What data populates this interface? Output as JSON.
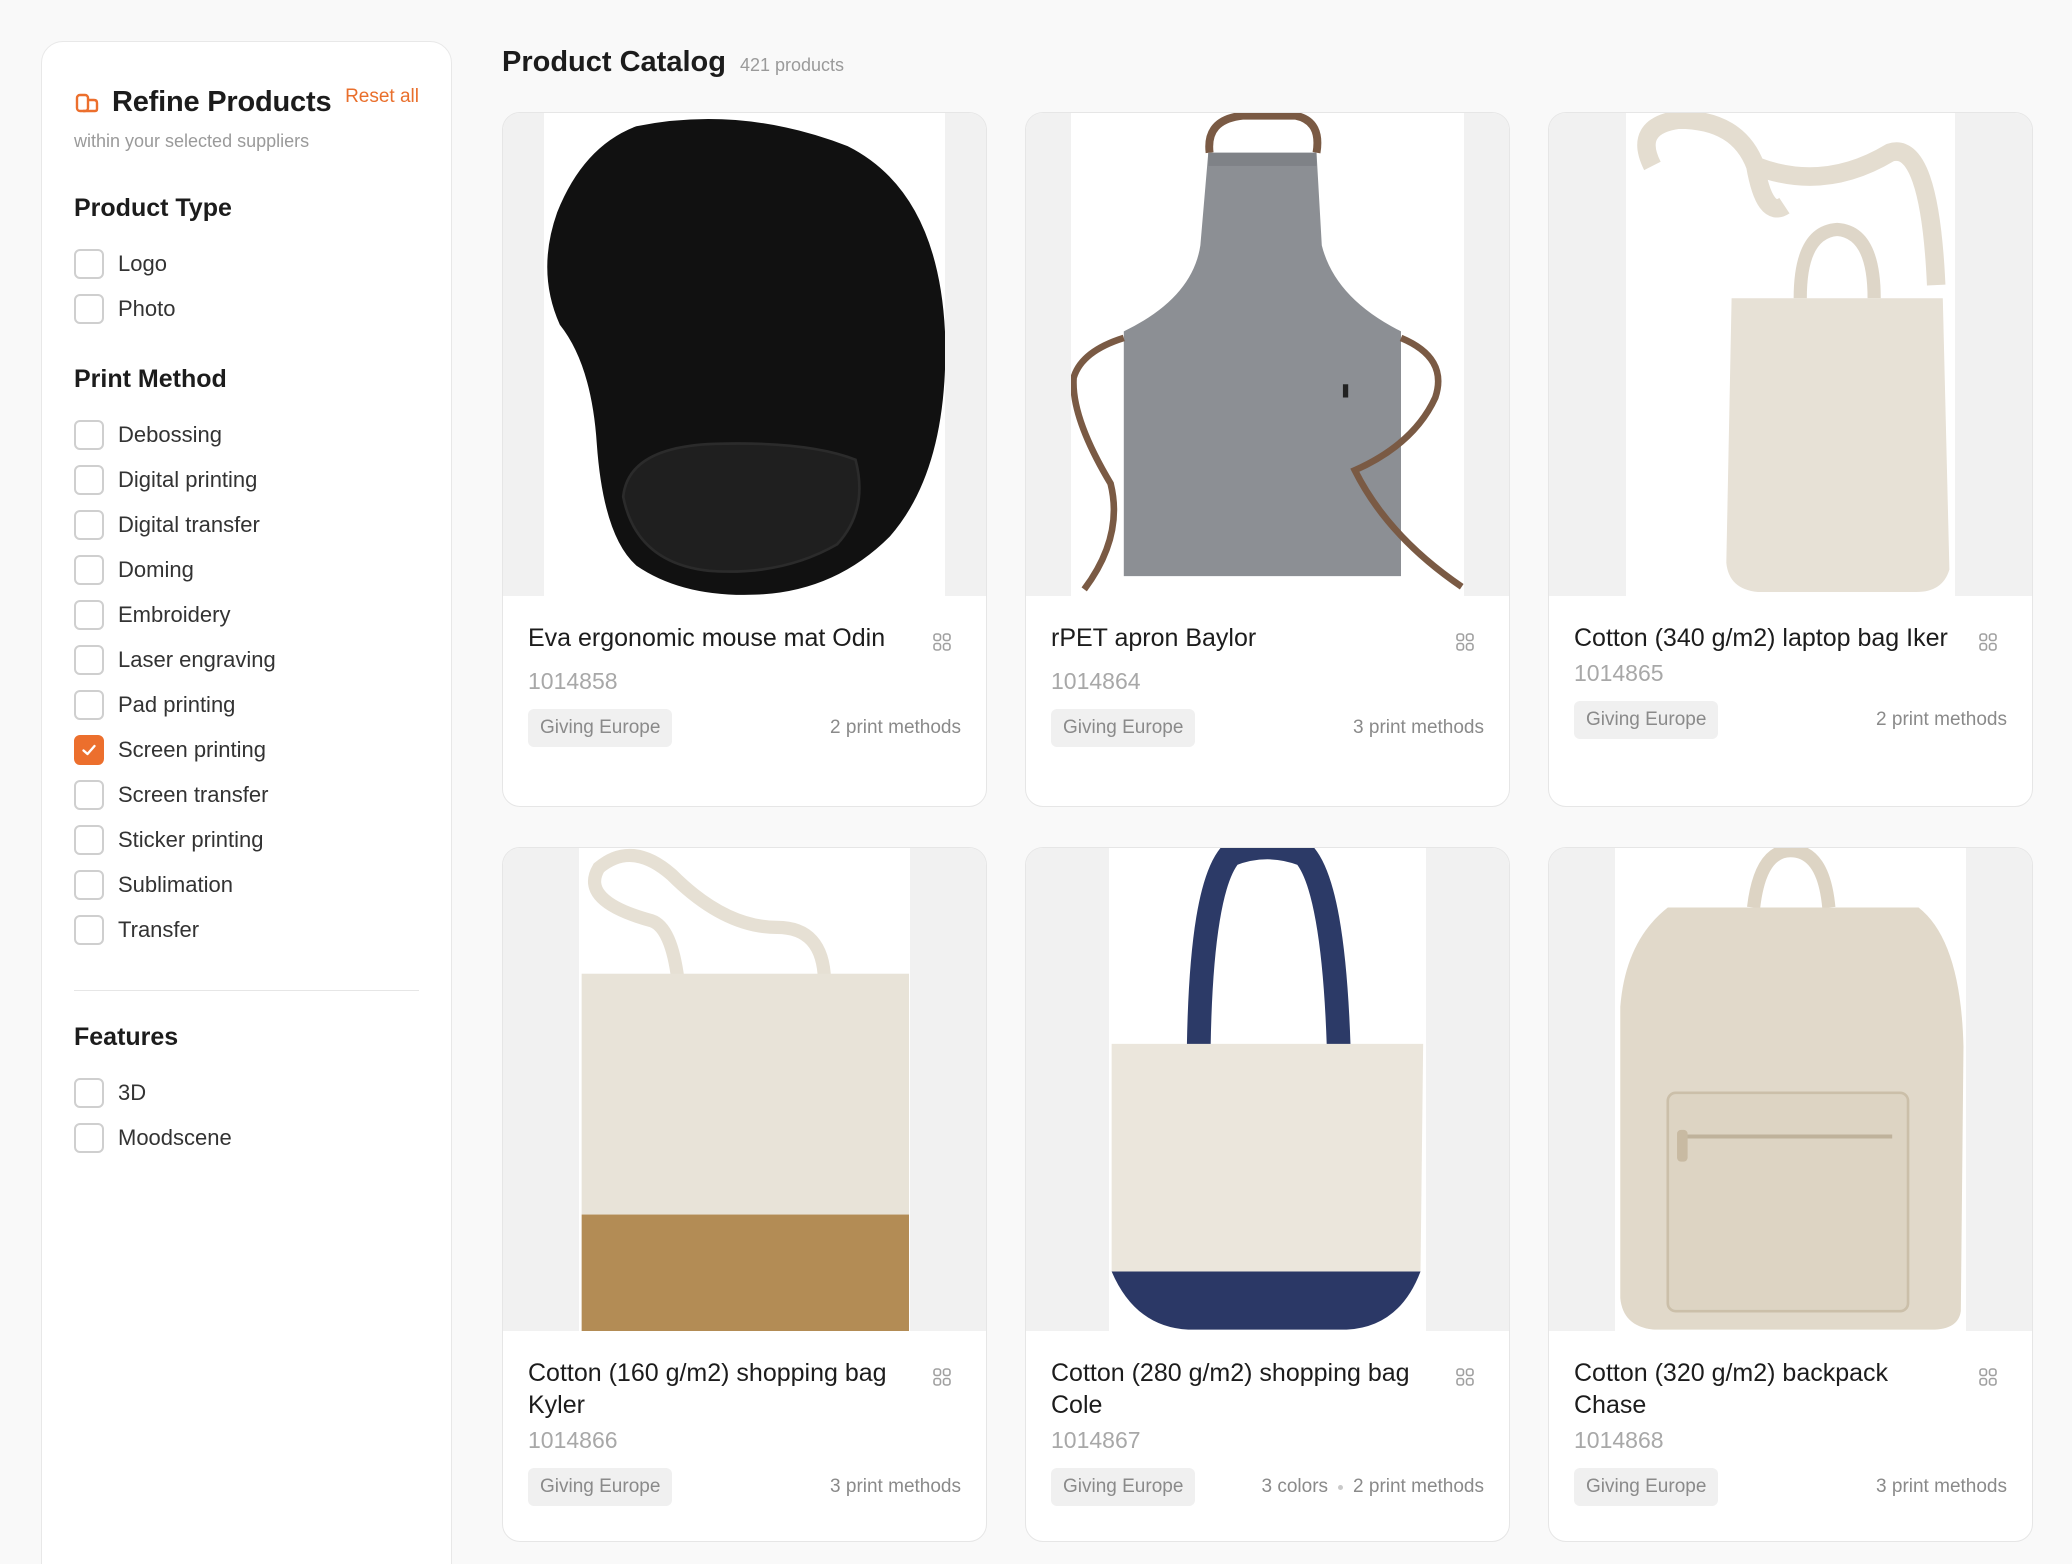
{
  "sidebar": {
    "title": "Refine Products",
    "reset_label": "Reset all",
    "subtitle": "within your selected suppliers",
    "groups": [
      {
        "title": "Product Type",
        "options": [
          {
            "label": "Logo",
            "checked": false
          },
          {
            "label": "Photo",
            "checked": false
          }
        ]
      },
      {
        "title": "Print Method",
        "options": [
          {
            "label": "Debossing",
            "checked": false
          },
          {
            "label": "Digital printing",
            "checked": false
          },
          {
            "label": "Digital transfer",
            "checked": false
          },
          {
            "label": "Doming",
            "checked": false
          },
          {
            "label": "Embroidery",
            "checked": false
          },
          {
            "label": "Laser engraving",
            "checked": false
          },
          {
            "label": "Pad printing",
            "checked": false
          },
          {
            "label": "Screen printing",
            "checked": true
          },
          {
            "label": "Screen transfer",
            "checked": false
          },
          {
            "label": "Sticker printing",
            "checked": false
          },
          {
            "label": "Sublimation",
            "checked": false
          },
          {
            "label": "Transfer",
            "checked": false
          }
        ]
      },
      {
        "title": "Features",
        "options": [
          {
            "label": "3D",
            "checked": false
          },
          {
            "label": "Moodscene",
            "checked": false
          }
        ]
      }
    ]
  },
  "catalog": {
    "title": "Product Catalog",
    "count_label": "421 products",
    "products": [
      {
        "name": "Eva ergonomic mouse mat Odin",
        "sku": "1014858",
        "supplier": "Giving Europe",
        "colors": "",
        "methods": "2 print methods",
        "image": "mouse-mat"
      },
      {
        "name": "rPET apron Baylor",
        "sku": "1014864",
        "supplier": "Giving Europe",
        "colors": "",
        "methods": "3 print methods",
        "image": "apron"
      },
      {
        "name": "Cotton (340 g/m2) laptop bag Iker",
        "sku": "1014865",
        "supplier": "Giving Europe",
        "colors": "",
        "methods": "2 print methods",
        "image": "laptop-bag"
      },
      {
        "name": "Cotton (160 g/m2) shopping bag Kyler",
        "sku": "1014866",
        "supplier": "Giving Europe",
        "colors": "",
        "methods": "3 print methods",
        "image": "shopping-bag-kyler"
      },
      {
        "name": "Cotton (280 g/m2) shopping bag Cole",
        "sku": "1014867",
        "supplier": "Giving Europe",
        "colors": "3 colors",
        "methods": "2 print methods",
        "image": "shopping-bag-cole"
      },
      {
        "name": "Cotton (320 g/m2) backpack Chase",
        "sku": "1014868",
        "supplier": "Giving Europe",
        "colors": "",
        "methods": "3 print methods",
        "image": "backpack"
      }
    ]
  },
  "colors": {
    "accent": "#ec6f2d",
    "text": "#1c1c1c",
    "muted": "#9a9a9a",
    "badge_bg": "#f0f0f0"
  },
  "icons": {
    "title_icon": "filter-icon",
    "card_icon": "grid-icon",
    "check_icon": "check-icon"
  }
}
